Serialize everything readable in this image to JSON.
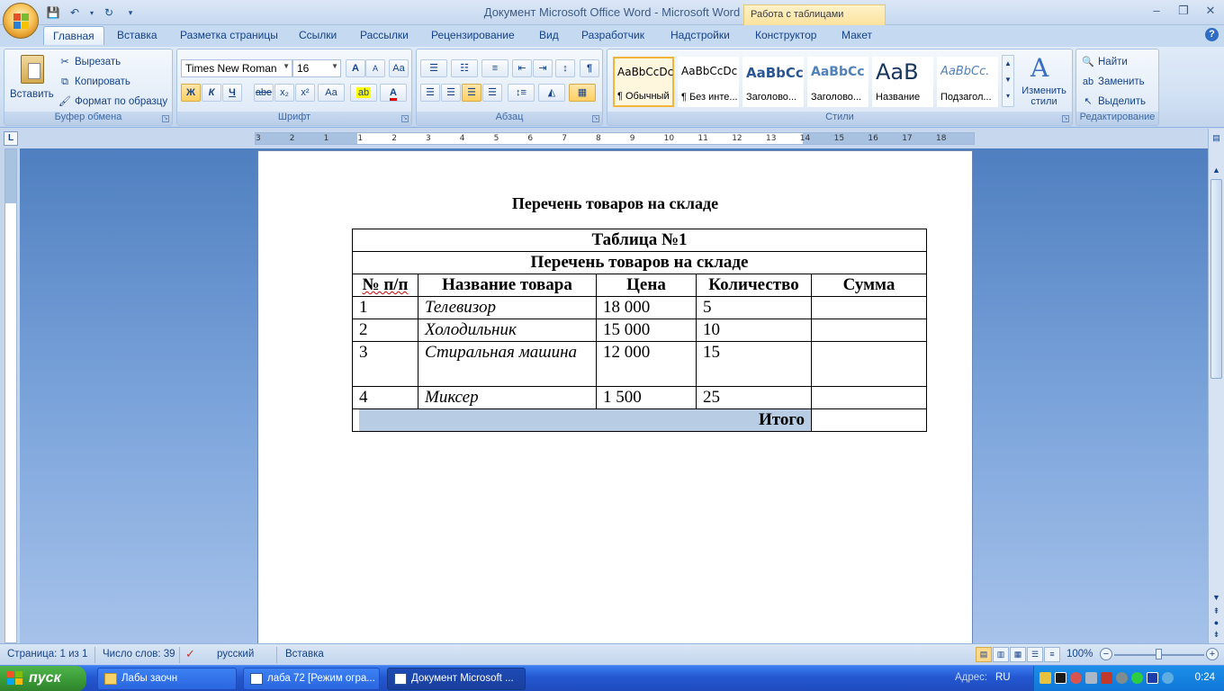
{
  "window": {
    "title": "Документ Microsoft Office Word - Microsoft Word",
    "context_group": "Работа с таблицами"
  },
  "tabs": [
    "Главная",
    "Вставка",
    "Разметка страницы",
    "Ссылки",
    "Рассылки",
    "Рецензирование",
    "Вид",
    "Разработчик",
    "Надстройки",
    "Конструктор",
    "Макет"
  ],
  "ribbon": {
    "clipboard": {
      "label": "Буфер обмена",
      "paste": "Вставить",
      "cut": "Вырезать",
      "copy": "Копировать",
      "format_painter": "Формат по образцу"
    },
    "font": {
      "label": "Шрифт",
      "font_name": "Times New Roman",
      "font_size": "16",
      "bold": "Ж",
      "italic": "К",
      "underline": "Ч",
      "strike": "abe",
      "subscript": "x₂",
      "superscript": "x²",
      "change_case": "Aa",
      "grow": "A",
      "shrink": "A"
    },
    "paragraph": {
      "label": "Абзац"
    },
    "styles": {
      "label": "Стили",
      "items": [
        {
          "sample": "AaBbCcDc",
          "name": "¶ Обычный"
        },
        {
          "sample": "AaBbCcDc",
          "name": "¶ Без инте..."
        },
        {
          "sample": "AaBbCc",
          "name": "Заголово..."
        },
        {
          "sample": "AaBbCc",
          "name": "Заголово..."
        },
        {
          "sample": "AaB",
          "name": "Название"
        },
        {
          "sample": "AaBbCc.",
          "name": "Подзагол..."
        }
      ],
      "change_styles": "Изменить стили"
    },
    "editing": {
      "label": "Редактирование",
      "find": "Найти",
      "replace": "Заменить",
      "select": "Выделить"
    }
  },
  "document": {
    "heading": "Перечень товаров  на складе",
    "table": {
      "caption": "Таблица №1",
      "subcaption": "Перечень товаров  на складе",
      "headers": [
        "№ п/п",
        "Название товара",
        "Цена",
        "Количество",
        "Сумма"
      ],
      "rows": [
        [
          "1",
          "Телевизор",
          "18 000",
          "5",
          ""
        ],
        [
          "2",
          "Холодильник",
          "15 000",
          "10",
          ""
        ],
        [
          "3",
          "Стиральная машина",
          "12 000",
          "15",
          ""
        ],
        [
          "4",
          "Миксер",
          "1 500",
          "25",
          ""
        ]
      ],
      "total_label": "Итого"
    }
  },
  "ruler_ticks": [
    "3",
    "2",
    "1",
    "1",
    "2",
    "3",
    "4",
    "5",
    "6",
    "7",
    "8",
    "9",
    "10",
    "11",
    "12",
    "13",
    "14",
    "15",
    "16",
    "17",
    "18"
  ],
  "statusbar": {
    "page": "Страница: 1 из 1",
    "words": "Число слов: 39",
    "language": "русский",
    "mode": "Вставка",
    "zoom": "100%"
  },
  "taskbar": {
    "start": "пуск",
    "items": [
      "Лабы заочн",
      "лаба 72 [Режим огра...",
      "Документ Microsoft ..."
    ],
    "address_label": "Адрес:",
    "lang": "RU",
    "clock": "0:24"
  }
}
